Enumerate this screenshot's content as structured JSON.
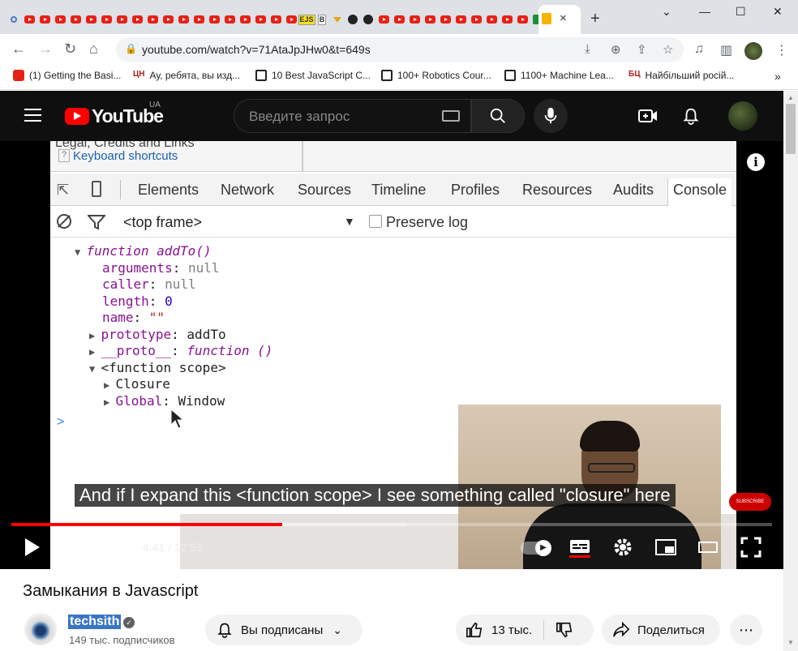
{
  "browser": {
    "url": "youtube.com/watch?v=71AtaJpJHw0&t=649s",
    "tab_close": "×",
    "new_tab": "+",
    "bookmarks": [
      {
        "label": "(1) Getting the Basi...",
        "icon": "youtube-icon"
      },
      {
        "label": "Ау, ребята, вы изд...",
        "icon": "tsn-icon",
        "badge": "ЦН"
      },
      {
        "label": "10 Best JavaScript C...",
        "icon": "coursera-icon"
      },
      {
        "label": "100+ Robotics Cour...",
        "icon": "coursera-icon"
      },
      {
        "label": "1100+ Machine Lea...",
        "icon": "coursera-icon"
      },
      {
        "label": "Найбільший росій...",
        "icon": "bc-icon",
        "badge": "БЦ"
      }
    ],
    "bookmarks_more": "»"
  },
  "youtube": {
    "logo_text": "YouTube",
    "country": "UA",
    "search_placeholder": "Введите запрос"
  },
  "video": {
    "devtools": {
      "help_line1": "Legal, Credits and Links",
      "help_line2": "Keyboard shortcuts",
      "help_q": "?",
      "tabs": [
        "Elements",
        "Network",
        "Sources",
        "Timeline",
        "Profiles",
        "Resources",
        "Audits",
        "Console"
      ],
      "frame_select": "<top frame>",
      "preserve_log": "Preserve log",
      "prompt": ">"
    },
    "code": {
      "l1_kw": "function",
      "l1_rest": " addTo()",
      "l2_key": "arguments",
      "l2_val": "null",
      "l3_key": "caller",
      "l3_val": "null",
      "l4_key": "length",
      "l4_val": "0",
      "l5_key": "name",
      "l5_val": "\"\"",
      "l6_key": "prototype",
      "l6_val": "addTo",
      "l7_key": "__proto__",
      "l7_kw": "function",
      "l7_rest": " ()",
      "l8": "<function scope>",
      "l9": "Closure",
      "l10_key": "Global",
      "l10_val": "Window",
      "sep": ": "
    },
    "caption": "And if I expand this <function scope> I see something called \"closure\" here",
    "subscribe_badge": "SUBSCRIBE",
    "progress": 0.356,
    "buffered": 0.52,
    "time_current": "4:41",
    "time_separator": " / ",
    "time_total": "12:51"
  },
  "below": {
    "title": "Замыкания в Javascript",
    "channel": "techsith",
    "verified": "✓",
    "subscribers": "149 тыс. подписчиков",
    "subscribed_label": "Вы подписаны",
    "likes": "13 тыс.",
    "share_label": "Поделиться",
    "more": "⋯"
  }
}
